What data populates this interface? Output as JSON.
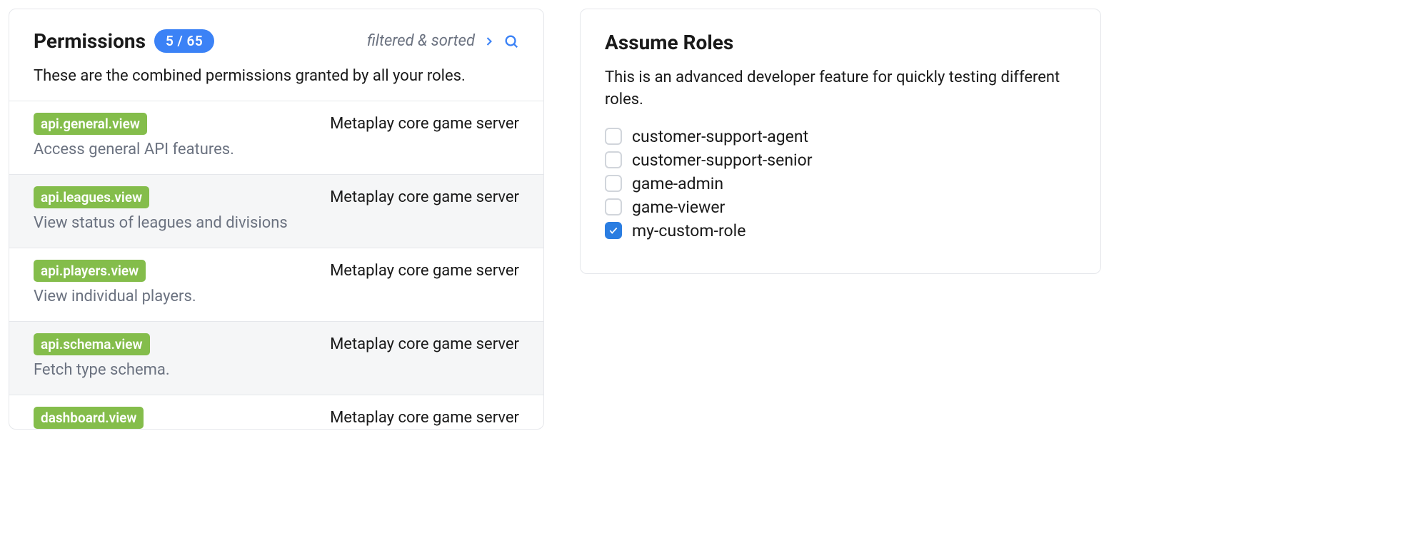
{
  "permissions": {
    "title": "Permissions",
    "count_badge": "5 / 65",
    "filter_label": "filtered & sorted",
    "subtitle": "These are the combined permissions granted by all your roles.",
    "items": [
      {
        "key": "api.general.view",
        "source": "Metaplay core game server",
        "desc": "Access general API features."
      },
      {
        "key": "api.leagues.view",
        "source": "Metaplay core game server",
        "desc": "View status of leagues and divisions"
      },
      {
        "key": "api.players.view",
        "source": "Metaplay core game server",
        "desc": "View individual players."
      },
      {
        "key": "api.schema.view",
        "source": "Metaplay core game server",
        "desc": "Fetch type schema."
      },
      {
        "key": "dashboard.view",
        "source": "Metaplay core game server",
        "desc": ""
      }
    ]
  },
  "roles": {
    "title": "Assume Roles",
    "subtitle": "This is an advanced developer feature for quickly testing different roles.",
    "items": [
      {
        "label": "customer-support-agent",
        "checked": false
      },
      {
        "label": "customer-support-senior",
        "checked": false
      },
      {
        "label": "game-admin",
        "checked": false
      },
      {
        "label": "game-viewer",
        "checked": false
      },
      {
        "label": "my-custom-role",
        "checked": true
      }
    ]
  }
}
